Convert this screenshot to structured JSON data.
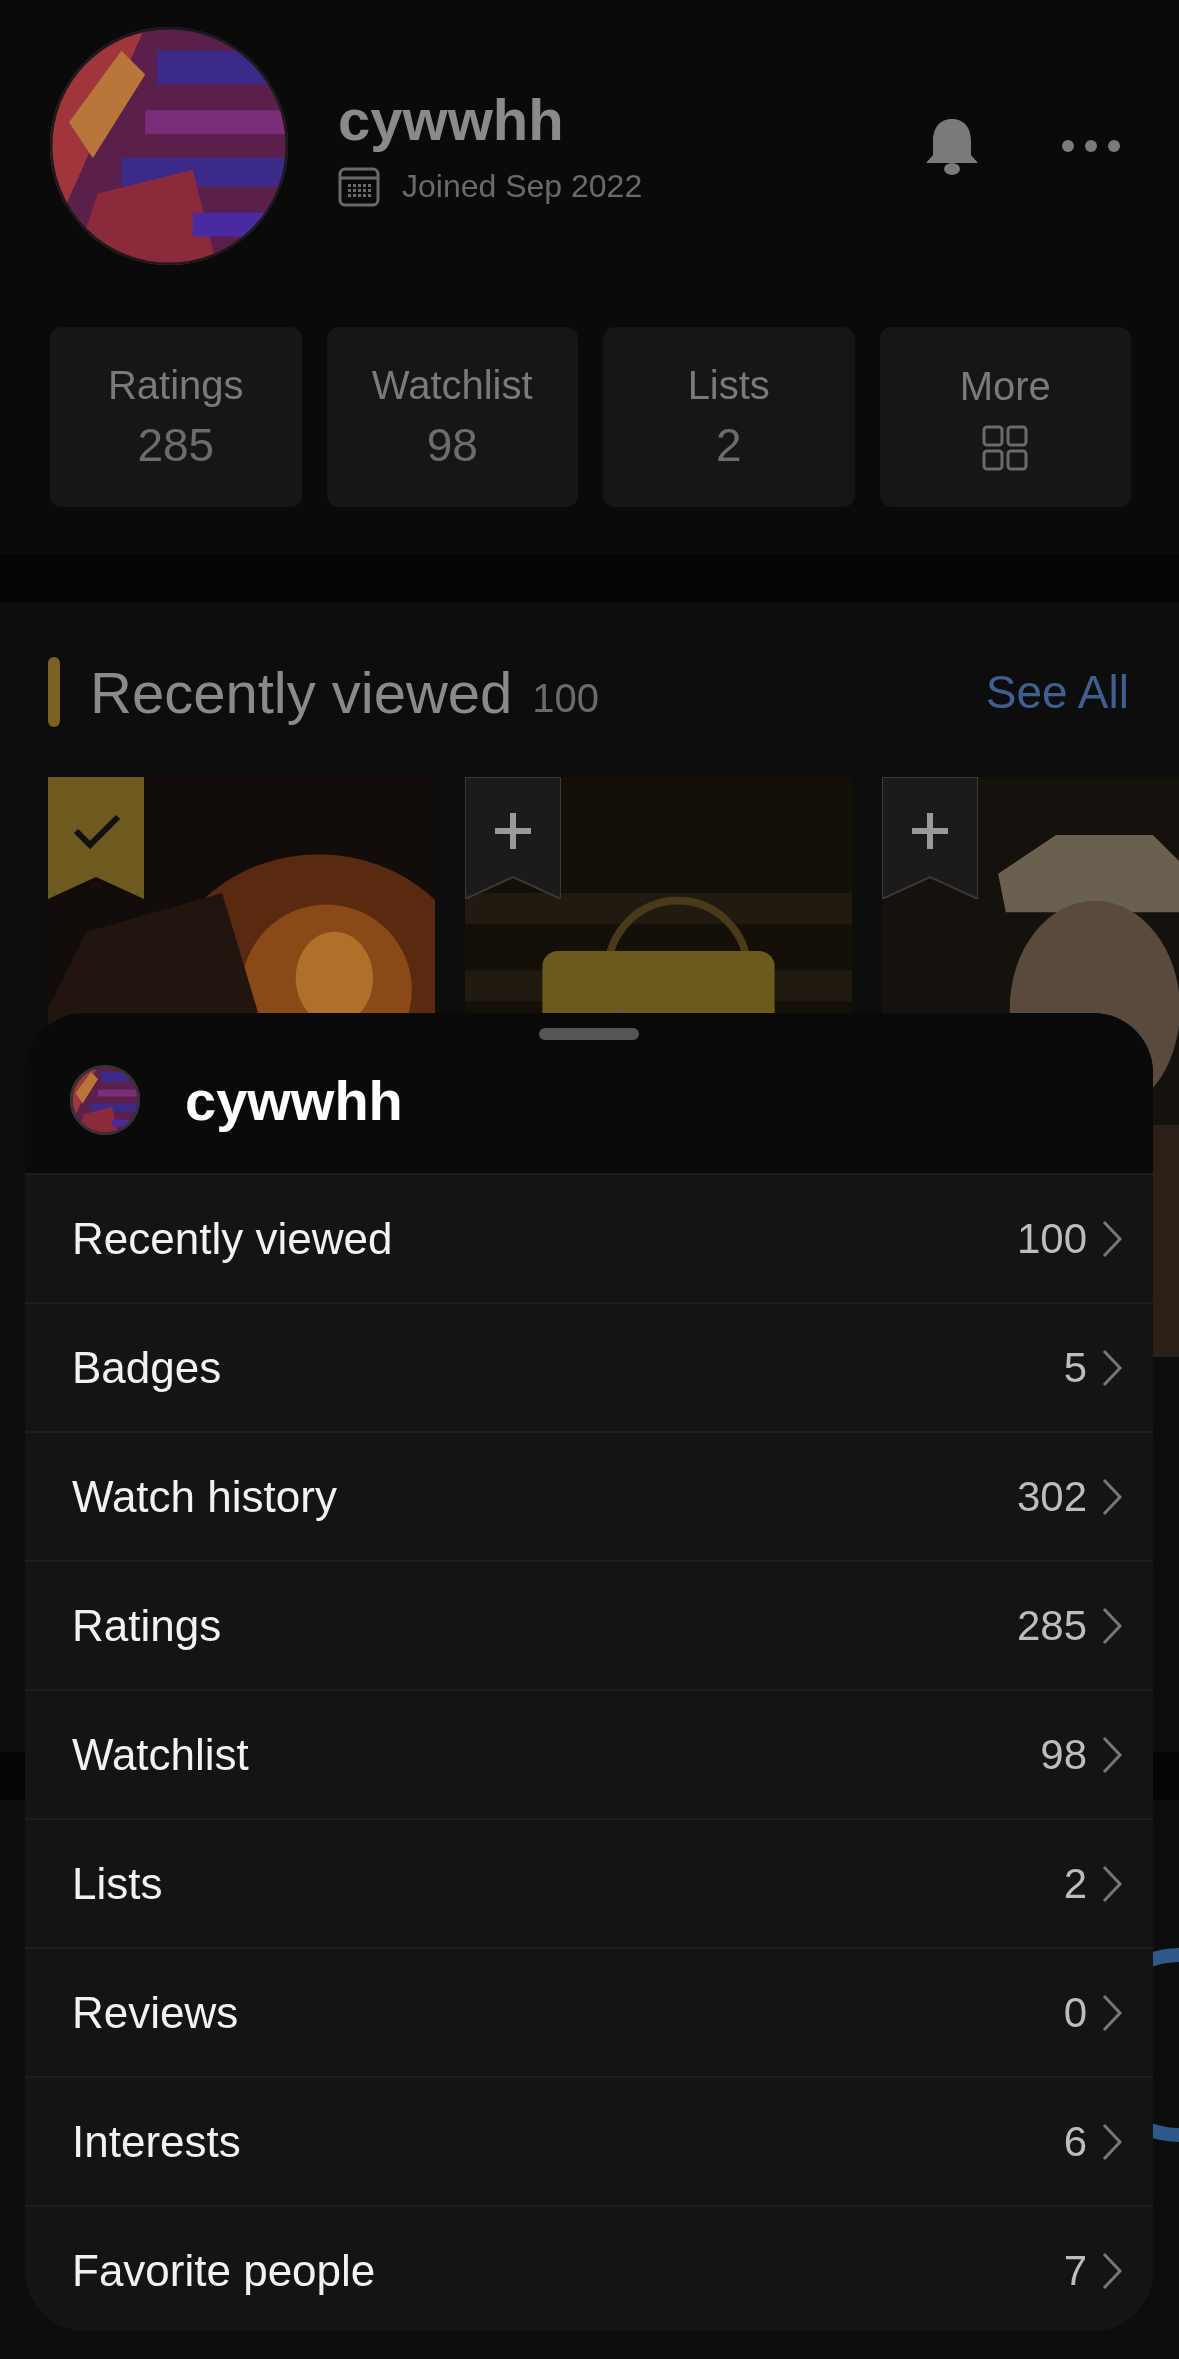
{
  "profile": {
    "username": "cywwhh",
    "joined": "Joined Sep 2022"
  },
  "stats": [
    {
      "label": "Ratings",
      "value": "285",
      "kind": "number"
    },
    {
      "label": "Watchlist",
      "value": "98",
      "kind": "number"
    },
    {
      "label": "Lists",
      "value": "2",
      "kind": "number"
    },
    {
      "label": "More",
      "kind": "grid"
    }
  ],
  "recently_viewed": {
    "title": "Recently viewed",
    "count": "100",
    "link": "See All",
    "posters": [
      {
        "kind": "picture",
        "in_watchlist": true
      },
      {
        "kind": "picture",
        "in_watchlist": false
      },
      {
        "kind": "picture",
        "in_watchlist": false
      }
    ]
  },
  "sheet": {
    "username": "cywwhh",
    "items": [
      {
        "label": "Recently viewed",
        "count": "100"
      },
      {
        "label": "Badges",
        "count": "5"
      },
      {
        "label": "Watch history",
        "count": "302"
      },
      {
        "label": "Ratings",
        "count": "285"
      },
      {
        "label": "Watchlist",
        "count": "98"
      },
      {
        "label": "Lists",
        "count": "2"
      },
      {
        "label": "Reviews",
        "count": "0"
      },
      {
        "label": "Interests",
        "count": "6"
      },
      {
        "label": "Favorite people",
        "count": "7"
      }
    ]
  }
}
